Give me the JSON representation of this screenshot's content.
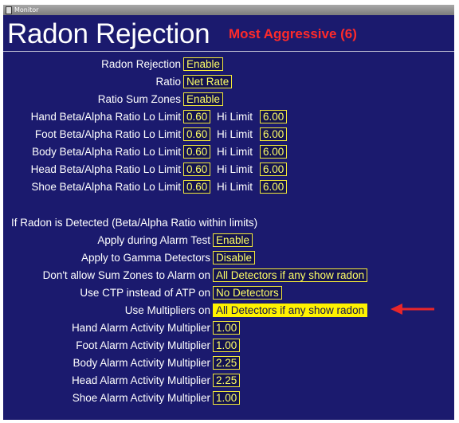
{
  "window": {
    "title": "Monitor"
  },
  "header": {
    "title": "Radon Rejection",
    "mode": "Most Aggressive (6)"
  },
  "settings": [
    {
      "label": "Radon Rejection",
      "value": "Enable"
    },
    {
      "label": "Ratio",
      "value": "Net Rate"
    },
    {
      "label": "Ratio Sum Zones",
      "value": "Enable"
    }
  ],
  "hi_limit_label": "Hi Limit",
  "ratio_limits": [
    {
      "label": "Hand Beta/Alpha Ratio Lo Limit",
      "lo": "0.60",
      "hi": "6.00"
    },
    {
      "label": "Foot Beta/Alpha Ratio Lo Limit",
      "lo": "0.60",
      "hi": "6.00"
    },
    {
      "label": "Body Beta/Alpha Ratio Lo Limit",
      "lo": "0.60",
      "hi": "6.00"
    },
    {
      "label": "Head Beta/Alpha Ratio Lo Limit",
      "lo": "0.60",
      "hi": "6.00"
    },
    {
      "label": "Shoe Beta/Alpha Ratio Lo Limit",
      "lo": "0.60",
      "hi": "6.00"
    }
  ],
  "detected": {
    "heading": "If Radon is Detected (Beta/Alpha Ratio within limits)",
    "options": [
      {
        "label": "Apply during Alarm Test",
        "value": "Enable"
      },
      {
        "label": "Apply to Gamma Detectors",
        "value": "Disable"
      },
      {
        "label": "Don't allow Sum Zones to Alarm on",
        "value": "All Detectors if any show radon"
      },
      {
        "label": "Use CTP instead of ATP on",
        "value": "No Detectors"
      },
      {
        "label": "Use Multipliers on",
        "value": "All Detectors if any show radon"
      }
    ]
  },
  "multipliers": [
    {
      "label": "Hand Alarm Activity Multiplier",
      "value": "1.00"
    },
    {
      "label": "Foot Alarm Activity Multiplier",
      "value": "1.00"
    },
    {
      "label": "Body Alarm Activity Multiplier",
      "value": "2.25"
    },
    {
      "label": "Head Alarm Activity Multiplier",
      "value": "2.25"
    },
    {
      "label": "Shoe Alarm Activity Multiplier",
      "value": "1.00"
    }
  ],
  "colors": {
    "panel": "#1b1a6e",
    "field_border": "#f4ea3a",
    "highlight": "#fff200",
    "accent_red": "#ff2a2a",
    "arrow": "#e8262a"
  },
  "icons": {
    "annotation": "red-arrow-icon",
    "app": "window-icon"
  }
}
